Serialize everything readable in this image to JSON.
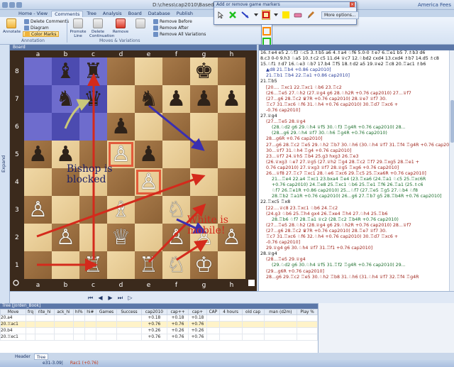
{
  "window": {
    "path": "D:\\chess\\cap2010\\Based\\...",
    "right_text": "America Fees"
  },
  "ribbon_tabs": [
    "Home - View",
    "Comments",
    "Tree",
    "Analysis",
    "Board",
    "Database",
    "Publish"
  ],
  "ribbon": {
    "annotate_label": "Annotate",
    "delete_comments": "Delete Comments",
    "diagram": "Diagram",
    "color_marks": "Color Marks",
    "annotation_group": "Annotation",
    "promote_line": "Promote Line",
    "delete_cont": "Delete Continuation",
    "remove": "Remove",
    "remove_before": "Remove Before",
    "remove_after": "Remove After",
    "remove_all_variations": "Remove All Variations",
    "moves_group": "Moves & Variations"
  },
  "marker_toolbar": {
    "title": "Add or remove game markers",
    "more_options": "More options...",
    "colors": {
      "red": "#d01515",
      "green": "#1fbf1f",
      "yellow": "#ffe700",
      "blue": "#2a3ec2",
      "orange": "#ff8a00"
    }
  },
  "board_pane": {
    "title": "Board",
    "files": [
      "a",
      "b",
      "c",
      "d",
      "e",
      "f",
      "g",
      "h"
    ],
    "ranks": [
      "8",
      "7",
      "6",
      "5",
      "4",
      "3",
      "2",
      "1"
    ],
    "annotation_bishop": "Bishop is blocked",
    "annotation_white": "White is mobile!"
  },
  "sidebar_expand": "Expand",
  "notation": [
    {
      "t": "16.♗e4 e5 2.♘f3 ♘c5 3.♗b5 a6 4.♗a4 ♘f6 5.0-0 ♗e7 6.♖e1 b5 7.♗b3 d6",
      "c": "main"
    },
    {
      "t": "8.c3 0-0 9.h3 ♘a5 10.♗c2 c5 11.d4 ♕c7 12.♘bd2 cxd4 13.cxd4 ♗b7 14.d5 ♗c8",
      "c": "main"
    },
    {
      "t": "15.♘f1 ♗d7 16.♘e3 ♘b7 17.b4 ♖f5 18.♗d2 a5 19.♕e2 ♖c8 20.♖ac1 ♗b6",
      "c": "main"
    },
    {
      "t": "▲d8 21.♖b4 +0.86 cap2010]",
      "c": "blue"
    },
    {
      "t": "21.♖b1 ♖b4 22.♖a1 +0.86 cap2010]",
      "c": "blue"
    },
    {
      "t": "21.♖b5",
      "c": "main"
    },
    {
      "t": "[20.... ♖xc1 22.♖xc1 ♘b6 23.♖c2",
      "c": "red"
    },
    {
      "t": "(26...♖e5 27.♘h2 (27.♕g4 g6 28.♘h2R +0.76 cap2010) 27...♕f7",
      "c": "red"
    },
    {
      "t": "(27...g6 28.♖c2 ♛7R +0.76 cap2010) 28.♕e7 ♕f7 30.",
      "c": "red"
    },
    {
      "t": "♖c7 31.♖xc6 ♘f6 31.♘h4 +0.76 cap2010) 30.♖d7 ♖xc6 +",
      "c": "red"
    },
    {
      "t": "-0.76 cap2010]",
      "c": "red"
    },
    {
      "t": "27.♕g4",
      "c": "main"
    },
    {
      "t": "(27...♖e5 28.♕g4",
      "c": "red"
    },
    {
      "t": "(28.♘d2 g6 29.♘h4 ♕f5 30.♘f3 ♖g4R +0.76 cap2010) 28...",
      "c": "green"
    },
    {
      "t": "(28...g6 29.♘h4 ♕f7 30.♘h6 ♖g4R +0.76 cap2010)",
      "c": "green"
    },
    {
      "t": "28...g6R +0.76 cap2010]",
      "c": "red"
    },
    {
      "t": "27...g6 28.♖c2 ♖e5 29.♘h2 ♖b7 30.♘h6 (30.♘h4 ♕f7 31.♖f4 ♖g4R +0.76 cap2010)",
      "c": "red"
    },
    {
      "t": "30...♕f7 31.♘h4 ♖g4 +0.76 cap2010]",
      "c": "red"
    },
    {
      "t": "23...♕f7 24.♕h5 ♖b4 25.g3 hxg3 26.♖e3",
      "c": "red"
    },
    {
      "t": "(26.♕xg3 ♘e7 27.♕g5 (27.♕h2 ♖g4 28.♖c2 ♖f7 29.♖xg5 28.♖e1 +",
      "c": "red"
    },
    {
      "t": "0.76 cap2010) 27.♕xg3 ♕f7 28.♕g5 ♖xg6 +0.76 cap2010]",
      "c": "red"
    },
    {
      "t": "26...♕f8 27.♖c7 ♖xc1 28.♘e6 ♖xc6 29.♖c5 25.♖xa6R +0.76 cap2010]",
      "c": "red"
    },
    {
      "t": "21...♖e4 22.a4 ♖xc1 23.bxa4 ♖e4 (23.♖xa6 (24.♖a1 ♘c5 25.♖xc6R",
      "c": "green"
    },
    {
      "t": "+0.76 cap2010) 24.♖e8 25.♖xc1 ♘b6 25.♖e1 ♖f6 26.♖a1 (25.♗c6",
      "c": "green"
    },
    {
      "t": "♘f7 26.♖e1R +0.86 cap2010) 25...♘f7 (27.♖e5 ♖g5 27.♘b4 ♘f8",
      "c": "green"
    },
    {
      "t": "28.♖b2 ♖a1R +0.76 cap2010) 26...g6 27.♖b7 g5 28.♖b4R +0.76 cap2010]",
      "c": "green"
    },
    {
      "t": "22.♖xc5 ♖x8",
      "c": "main"
    },
    {
      "t": "[22....♕c8 23.♖xc1 ♘b6 24.♖c2",
      "c": "red"
    },
    {
      "t": "(24.g3 ♘b6 25.♖h4 gx4 26.♖xe4 ♖h4 27.♘h4 25.♖b6",
      "c": "red"
    },
    {
      "t": "28.♖b6 ♘f7 28.♖a1 ♕c2 (28.♖c2 ♖b4R +0.76 cap2010)",
      "c": "green"
    },
    {
      "t": "(27...♖e5 28.♘h2 (28.♕g4 g6 29.♘h2R +0.76 cap2010) 28...♕f7",
      "c": "red"
    },
    {
      "t": "(27...g6 28.♖c2 ♛7R +0.76 cap2010) 28.♖e7 ♕f7 30.",
      "c": "red"
    },
    {
      "t": "♖c7 31.♖xc6 ♘f6 32.♘h4 +0.76 cap2010) 30.♖d7 ♖xc6 +",
      "c": "red"
    },
    {
      "t": "-0.76 cap2010]",
      "c": "red"
    },
    {
      "t": "29.♕g4 g6 30.♘h4 ♕f7 31.♖f1 +0.76 cap2010]",
      "c": "red"
    },
    {
      "t": "28.♕g4",
      "c": "main"
    },
    {
      "t": "(28...♖e5 29.♕g4",
      "c": "red"
    },
    {
      "t": "(29.♘d2 g6 30.♘h4 ♕f5 31.♖f2 ♖g4R +0.76 cap2010) 29...",
      "c": "green"
    },
    {
      "t": "(29...g6R +0.76 cap2010]",
      "c": "red"
    },
    {
      "t": "28...g6 29.♖c2 ♖e5 30.♘h2 ♖b8 31.♘h6 (31.♘h4 ♕f7 32.♖f4 ♖g4R",
      "c": "red"
    }
  ],
  "tree": {
    "header": "Tree [Jorden_Book]",
    "columns": [
      "Move",
      "frq",
      "rite_hi",
      "ack_hi",
      "hi%",
      "hi#",
      "Games",
      "Success",
      "cap2010",
      "cap++",
      "cap+",
      "CAP",
      "4 hours",
      "old cap",
      "man (d2m)",
      "Play %"
    ],
    "rows": [
      {
        "move": "20.a4",
        "cap2010": "+0.18",
        "cap_pp": "+0.18",
        "cap_p": "+0.18",
        "sel": false
      },
      {
        "move": "20.♖ac1",
        "cap2010": "+0.76",
        "cap_pp": "+0.76",
        "cap_p": "+0.76",
        "sel": true
      },
      {
        "move": "20.b4",
        "cap2010": "+0.26",
        "cap_pp": "+0.26",
        "cap_p": "+0.26",
        "sel": false
      },
      {
        "move": "20.♖ec1",
        "cap2010": "+0.76",
        "cap_pp": "+0.76",
        "cap_p": "+0.76",
        "sel": false
      }
    ]
  },
  "bottom_tabs": [
    "Header",
    "Tree"
  ],
  "status": {
    "left": "e31-3.09|",
    "eval": "Rac1 (+0.76)"
  }
}
